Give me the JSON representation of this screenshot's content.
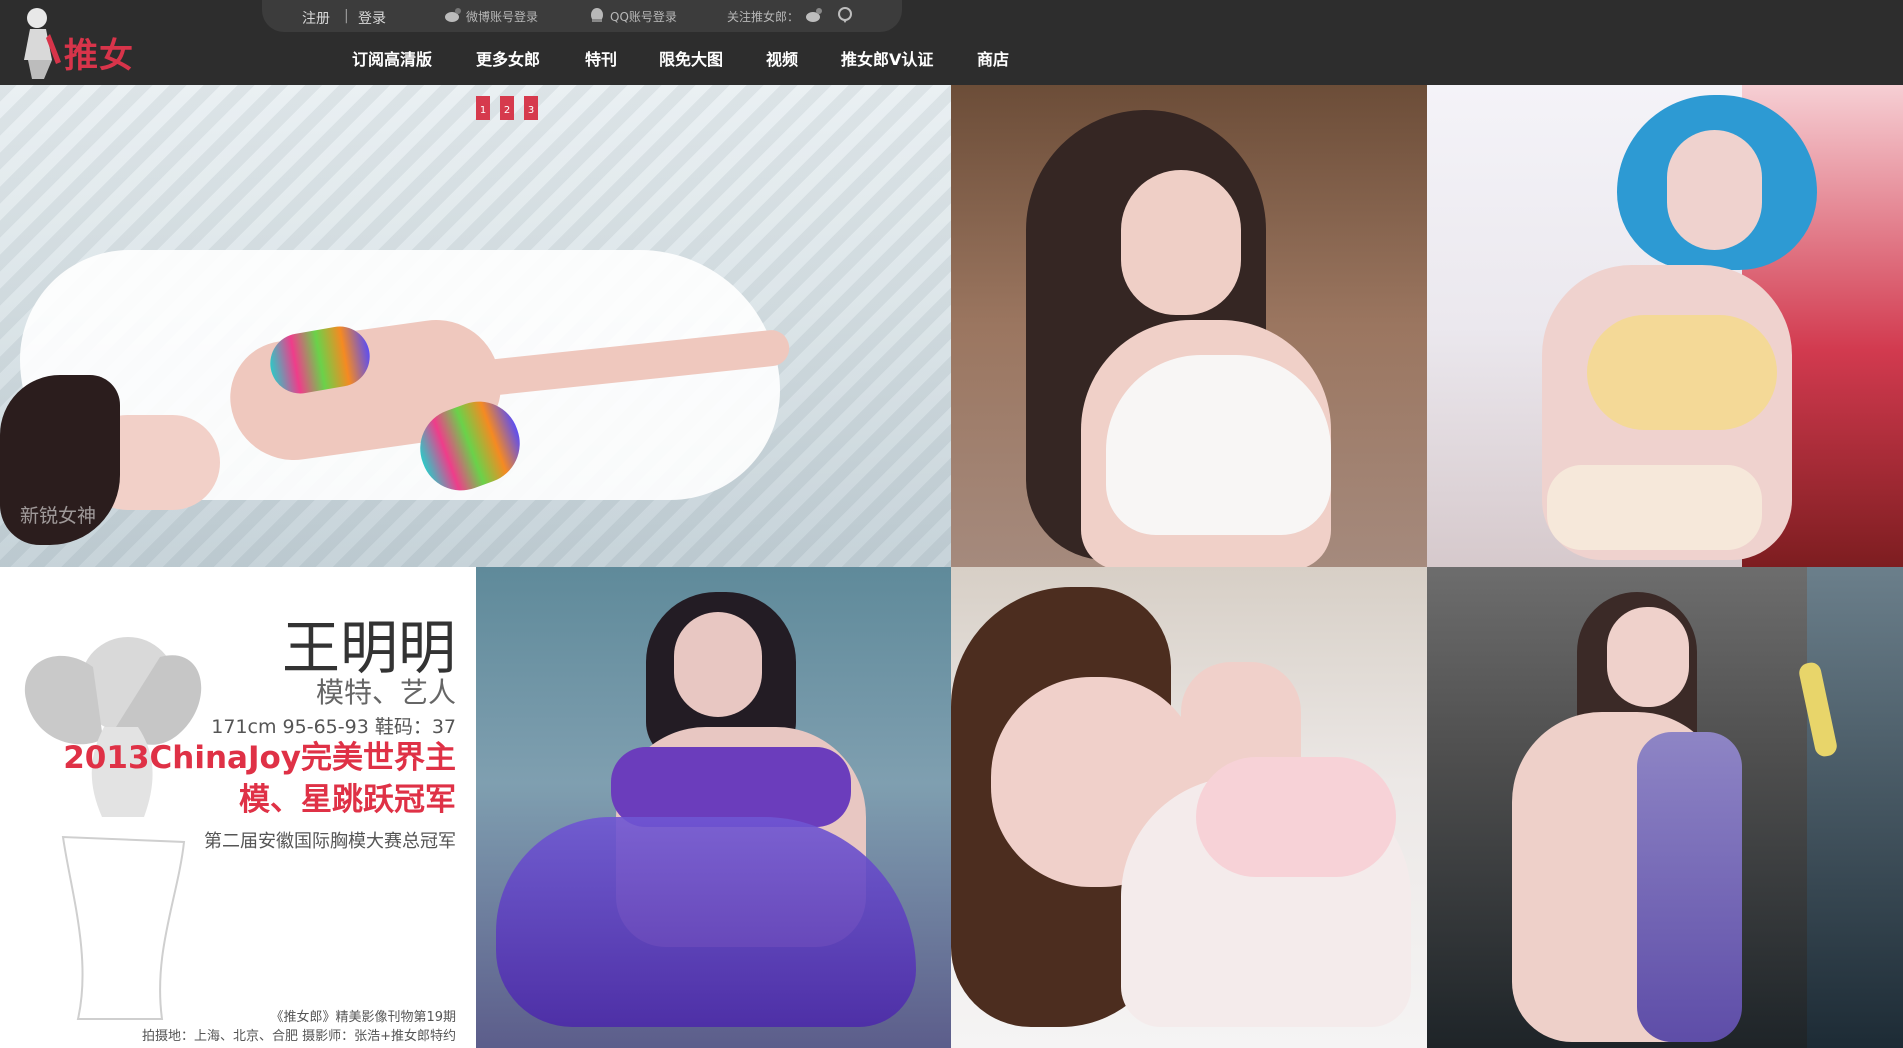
{
  "header": {
    "logo_text": "推女郎",
    "auth": {
      "register": "注册",
      "separator": "|",
      "login": "登录",
      "weibo_login": "微博账号登录",
      "qq_login": "QQ账号登录",
      "follow_label": "关注推女郎："
    },
    "nav": [
      "订阅高清版",
      "更多女郎",
      "特刊",
      "限免大图",
      "视频",
      "推女郎V认证",
      "商店"
    ],
    "slider_dots": [
      "1",
      "2",
      "3"
    ]
  },
  "gallery": {
    "watermark": "新锐女神",
    "profile": {
      "name": "王明明",
      "role": "模特、艺人",
      "stats": "171cm 95-65-93 鞋码：37",
      "headline": "2013ChinaJoy完美世界主模、星跳跃冠军",
      "award": "第二届安徽国际胸模大赛总冠军",
      "footer_1": "《推女郎》精美影像刊物第19期",
      "footer_2": "拍摄地：上海、北京、合肥 摄影师：张浩+推女郎特约"
    }
  },
  "colors": {
    "brand": "#d8344a",
    "header_bg": "#2d2d2d"
  },
  "icons": [
    "weibo-icon",
    "qq-icon",
    "tencent-weibo-icon"
  ]
}
